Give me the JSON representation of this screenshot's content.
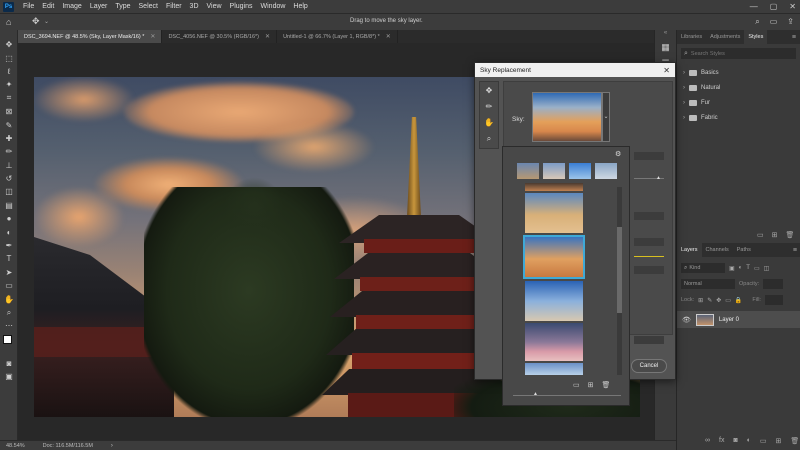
{
  "app": {
    "logo": "Ps"
  },
  "menu": [
    "File",
    "Edit",
    "Image",
    "Layer",
    "Type",
    "Select",
    "Filter",
    "3D",
    "View",
    "Plugins",
    "Window",
    "Help"
  ],
  "options": {
    "hint": "Drag to move the sky layer."
  },
  "tabs": [
    {
      "label": "DSC_3694.NEF @ 48.5% (Sky, Layer Mask/16) *",
      "active": true
    },
    {
      "label": "DSC_4056.NEF @ 30.5% (RGB/16*)",
      "active": false
    },
    {
      "label": "Untitled-1 @ 66.7% (Layer 1, RGB/8*) *",
      "active": false
    }
  ],
  "status": {
    "zoom": "48.54%",
    "doc": "Doc: 116.5M/116.5M"
  },
  "panels": {
    "top_tabs": [
      "Libraries",
      "Adjustments",
      "Styles"
    ],
    "search_placeholder": "Search Styles",
    "style_groups": [
      "Basics",
      "Natural",
      "Fur",
      "Fabric"
    ],
    "layer_tabs": [
      "Layers",
      "Channels",
      "Paths"
    ],
    "kind_label": "Kind",
    "blend_mode": "Normal",
    "opacity_label": "Opacity:",
    "lock_label": "Lock:",
    "fill_label": "Fill:",
    "layer_name": "Layer 0"
  },
  "dialog": {
    "title": "Sky Replacement",
    "sky_label": "Sky:",
    "cancel": "Cancel"
  },
  "colors": {
    "accent": "#31a8ff",
    "selected_thumb_border": "#3fa9d6"
  }
}
